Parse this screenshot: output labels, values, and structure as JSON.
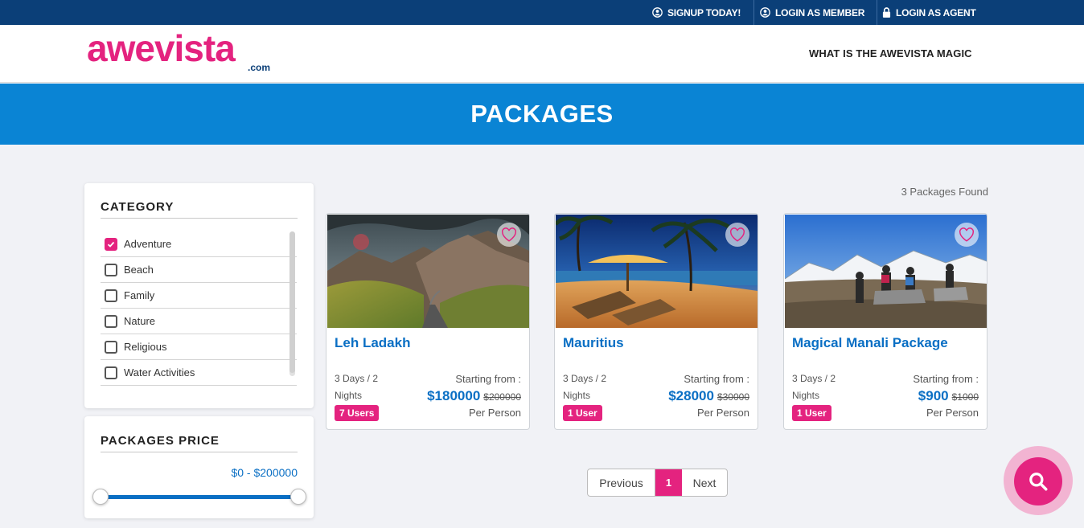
{
  "topbar": {
    "signup": "SIGNUP TODAY!",
    "login_member": "LOGIN AS MEMBER",
    "login_agent": "LOGIN AS AGENT"
  },
  "header": {
    "logo_text": "awevista",
    "logo_suffix": ".com",
    "nav_magic": "WHAT IS THE AWEVISTA MAGIC"
  },
  "banner": {
    "title": "PACKAGES"
  },
  "filters": {
    "category_title": "CATEGORY",
    "categories": [
      {
        "label": "Adventure",
        "checked": true
      },
      {
        "label": "Beach",
        "checked": false
      },
      {
        "label": "Family",
        "checked": false
      },
      {
        "label": "Nature",
        "checked": false
      },
      {
        "label": "Religious",
        "checked": false
      },
      {
        "label": "Water Activities",
        "checked": false
      }
    ],
    "price_title": "PACKAGES PRICE",
    "price_range_label": "$0 - $200000",
    "price_min": 0,
    "price_max": 200000
  },
  "results": {
    "found_text": "3 Packages Found"
  },
  "packages": [
    {
      "title": "Leh Ladakh",
      "duration_line1": "3 Days / 2",
      "duration_line2": "Nights",
      "users": "7 Users",
      "starting_label": "Starting from :",
      "price": "$180000",
      "old_price": "$200000",
      "per_person": "Per Person"
    },
    {
      "title": "Mauritius",
      "duration_line1": "3 Days / 2",
      "duration_line2": "Nights",
      "users": "1 User",
      "starting_label": "Starting from :",
      "price": "$28000",
      "old_price": "$30000",
      "per_person": "Per Person"
    },
    {
      "title": "Magical Manali Package",
      "duration_line1": "3 Days / 2",
      "duration_line2": "Nights",
      "users": "1 User",
      "starting_label": "Starting from :",
      "price": "$900",
      "old_price": "$1000",
      "per_person": "Per Person"
    }
  ],
  "pagination": {
    "previous": "Previous",
    "current": "1",
    "next": "Next"
  },
  "colors": {
    "brand_pink": "#e4237f",
    "brand_blue": "#0a84d4",
    "navy": "#0b3f78"
  },
  "icons": {
    "fab": "search-icon",
    "favorite": "heart-icon",
    "user": "user-circle-icon",
    "agent": "lock-icon"
  }
}
